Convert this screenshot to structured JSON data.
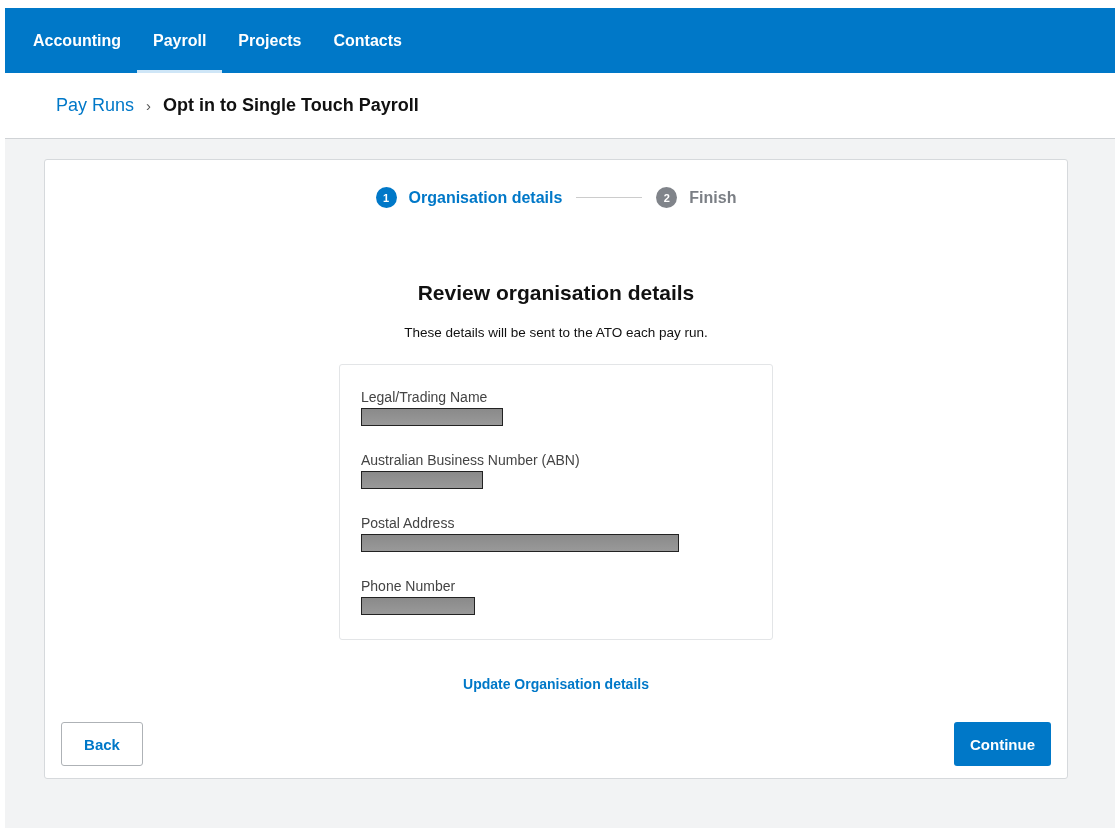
{
  "nav": [
    {
      "label": "Accounting",
      "selected": false
    },
    {
      "label": "Payroll",
      "selected": true
    },
    {
      "label": "Projects",
      "selected": false
    },
    {
      "label": "Contacts",
      "selected": false
    }
  ],
  "breadcrumb": {
    "parent": "Pay Runs",
    "separator": "›",
    "current": "Opt in to Single Touch Payroll"
  },
  "steps": [
    {
      "number": "1",
      "label": "Organisation details",
      "selected": true
    },
    {
      "number": "2",
      "label": "Finish",
      "selected": false
    }
  ],
  "heading": "Review organisation details",
  "subheading": "These details will be sent to the ATO each pay run.",
  "fields": [
    {
      "label": "Legal/Trading Name",
      "redacted": true
    },
    {
      "label": "Australian Business Number (ABN)",
      "redacted": true
    },
    {
      "label": "Postal Address",
      "redacted": true
    },
    {
      "label": "Phone Number",
      "redacted": true
    }
  ],
  "update_link": "Update Organisation details",
  "buttons": {
    "back": "Back",
    "continue": "Continue"
  }
}
